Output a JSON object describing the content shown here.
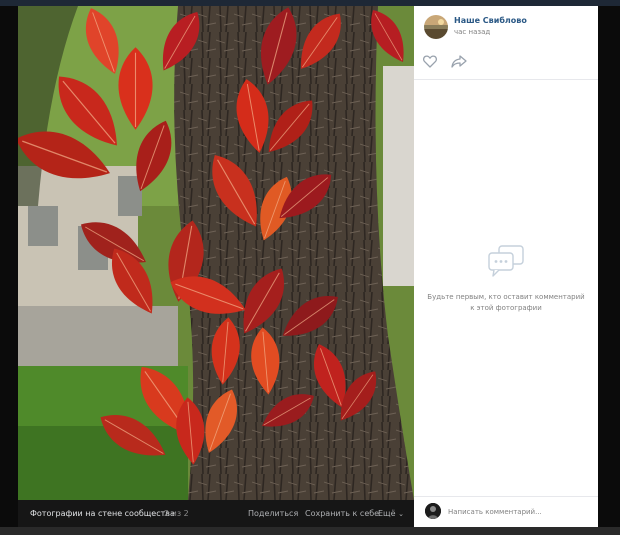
{
  "post": {
    "author": "Наше Свиблово",
    "time": "час назад"
  },
  "actions": {
    "like_icon": "heart-outline-icon",
    "share_icon": "share-arrow-icon"
  },
  "comments": {
    "empty_icon": "chat-bubble-icon",
    "empty_text": "Будьте первым, кто оставит комментарий к этой фотографии",
    "input_placeholder": "Написать комментарий..."
  },
  "footer": {
    "album": "Фотографии на стене сообщества",
    "counter": "2 из 2",
    "share": "Поделиться",
    "save": "Сохранить к себе",
    "more": "Ещё",
    "more_icon": "chevron-down-icon"
  },
  "photo": {
    "subject": "red-autumn-vine-leaves-on-tree-trunk"
  },
  "colors": {
    "link": "#2a5885",
    "muted": "#828282",
    "footer_bg": "#161616",
    "sidebar_bg": "#ffffff",
    "leaf_red": "#c8281c",
    "bark": "#4a4036"
  }
}
